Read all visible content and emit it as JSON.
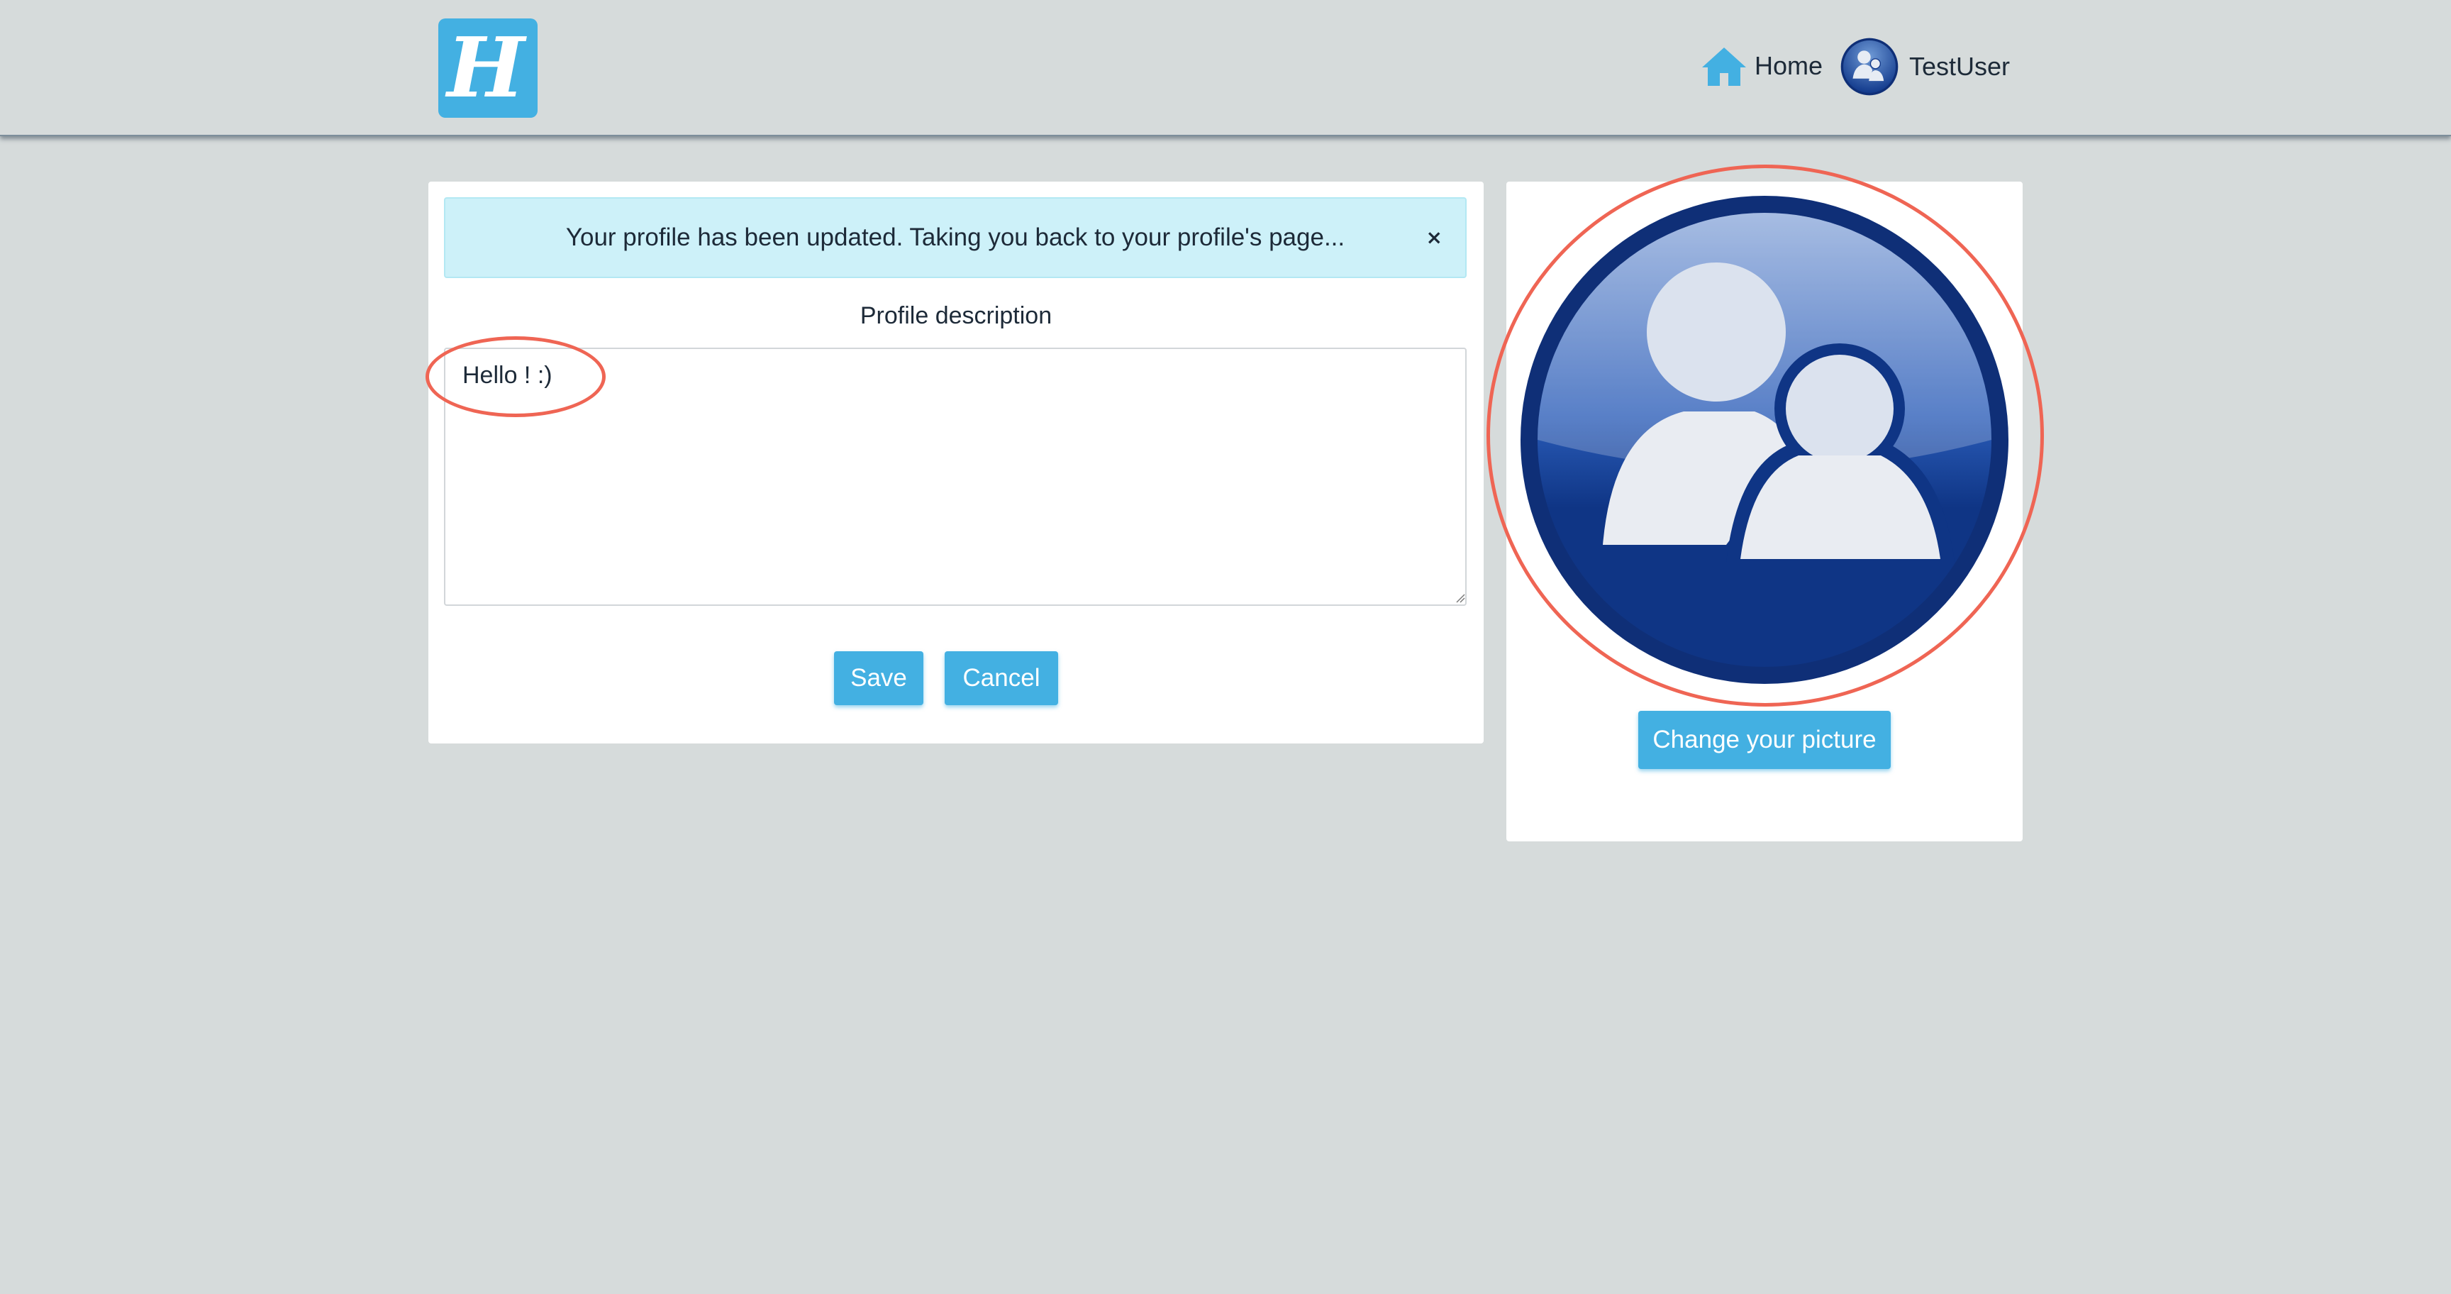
{
  "header": {
    "logo_letter": "H",
    "nav_home_label": "Home",
    "nav_user_label": "TestUser",
    "icons": [
      "home-icon",
      "user-avatar-icon"
    ]
  },
  "alert": {
    "message": "Your profile has been updated. Taking you back to your profile's page...",
    "close_symbol": "×"
  },
  "profile_form": {
    "description_label": "Profile description",
    "description_value": "Hello ! :)",
    "save_label": "Save",
    "cancel_label": "Cancel"
  },
  "picture_panel": {
    "change_picture_label": "Change your picture",
    "icon": "default-profile-picture"
  },
  "colors": {
    "page_background": "#d6dbdb",
    "accent": "#43b0e2",
    "alert_background": "#cdf1f9",
    "avatar_blue": "#0f3585",
    "annotation": "#ef6554"
  }
}
